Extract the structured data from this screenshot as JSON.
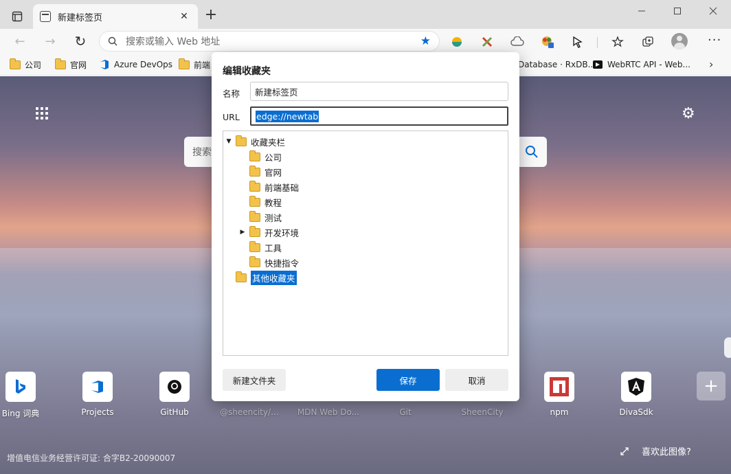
{
  "tab": {
    "title": "新建标签页",
    "close_glyph": "✕"
  },
  "toolbar": {
    "address_placeholder": "搜索或输入 Web 地址"
  },
  "favorites_bar": {
    "items": [
      {
        "label": "公司",
        "icon": "folder-icon"
      },
      {
        "label": "官网",
        "icon": "folder-icon"
      },
      {
        "label": "Azure DevOps",
        "icon": "azure-devops-icon"
      },
      {
        "label": "前端",
        "icon": "folder-icon"
      },
      {
        "label": "Database · RxDB...",
        "icon": "page-icon"
      },
      {
        "label": "WebRTC API - Web...",
        "icon": "page-icon"
      }
    ]
  },
  "newtab": {
    "search_placeholder": "搜索",
    "quick_links": [
      {
        "label": "Bing 词典",
        "icon": "bing-icon",
        "dim": false
      },
      {
        "label": "Projects",
        "icon": "azure-devops-icon",
        "dim": false
      },
      {
        "label": "GitHub",
        "icon": "github-icon",
        "dim": false
      },
      {
        "label": "@sheencity/d...",
        "icon": "",
        "dim": true
      },
      {
        "label": "MDN Web Do...",
        "icon": "",
        "dim": true
      },
      {
        "label": "Git",
        "icon": "",
        "dim": true
      },
      {
        "label": "SheenCity",
        "icon": "",
        "dim": true
      },
      {
        "label": "npm",
        "icon": "npm-icon",
        "dim": false
      },
      {
        "label": "DivaSdk",
        "icon": "angular-icon",
        "dim": false
      }
    ],
    "license_text": "增值电信业务经营许可证: 合字B2-20090007",
    "like_image_text": "喜欢此图像?"
  },
  "dialog": {
    "title": "编辑收藏夹",
    "name_label": "名称",
    "name_value": "新建标签页",
    "url_label": "URL",
    "url_value": "edge://newtab",
    "tree": {
      "root": "收藏夹栏",
      "children": [
        "公司",
        "官网",
        "前端基础",
        "教程",
        "测试",
        "开发环境",
        "工具",
        "快捷指令"
      ],
      "other": "其他收藏夹"
    },
    "new_folder_button": "新建文件夹",
    "save_button": "保存",
    "cancel_button": "取消"
  },
  "colors": {
    "accent": "#0a6ed1",
    "folder": "#f3c24b"
  }
}
